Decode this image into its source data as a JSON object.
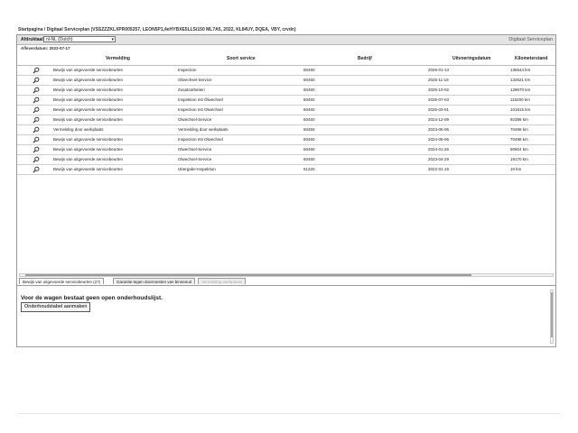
{
  "breadcrumb": "Startpagina / Digitaal Serviceplan (VSSZZZKLXPR005257, LEON5P1,4eHYBXE5LLSi150 ML7A5, 2022, KL84UY, DQEA, VBY, crvdn)",
  "toolbar": {
    "print_label": "Afdruktaal:",
    "language_value": "nl-NL (Dutch)",
    "app_title": "Digitaal Serviceplan"
  },
  "issue_date": "Afleverdatum: 2022-07-17",
  "table": {
    "columns": [
      "Vermelding",
      "Soort service",
      "Bedrijf",
      "Uitvoeringsdatum",
      "Kilometerstand"
    ],
    "rows": [
      {
        "vermelding": "Bewijs van uitgevoerde servicebeurten",
        "soort": "Inspection",
        "bedrijf": "60450",
        "datum": "2026-01-13",
        "km": "136544 km"
      },
      {
        "vermelding": "Bewijs van uitgevoerde servicebeurten",
        "soort": "Olieechsel-Service",
        "bedrijf": "60450",
        "datum": "2025-11-19",
        "km": "132621 km"
      },
      {
        "vermelding": "Bewijs van uitgevoerde servicebeurten",
        "soort": "Zusatzarbeiten",
        "bedrijf": "60450",
        "datum": "2025-10-02",
        "km": "128670 km"
      },
      {
        "vermelding": "Bewijs van uitgevoerde servicebeurten",
        "soort": "Inspektion mit Ölwechsel",
        "bedrijf": "60450",
        "datum": "2025-07-03",
        "km": "115200 km"
      },
      {
        "vermelding": "Bewijs van uitgevoerde servicebeurten",
        "soort": "Inspection mit Olwechsel",
        "bedrijf": "60450",
        "datum": "2025-03-01",
        "km": "101815 km"
      },
      {
        "vermelding": "Bewijs van uitgevoerde servicebeurten",
        "soort": "Olwechsel-Service",
        "bedrijf": "60450",
        "datum": "2024-12-09",
        "km": "92388 km"
      },
      {
        "vermelding": "Vermelding door werkplaats",
        "soort": "Vermelding door werkplaats",
        "bedrijf": "60450",
        "datum": "2024-06-06",
        "km": "70498 km"
      },
      {
        "vermelding": "Bewijs van uitgevoerde servicebeurten",
        "soort": "Inspection mit Olwechsel",
        "bedrijf": "60450",
        "datum": "2024-06-06",
        "km": "70498 km"
      },
      {
        "vermelding": "Bewijs van uitgevoerde servicebeurten",
        "soort": "Olwechsel-Service",
        "bedrijf": "60450",
        "datum": "2024-01-26",
        "km": "50804 km"
      },
      {
        "vermelding": "Bewijs van uitgevoerde servicebeurten",
        "soort": "Olwechsel-Service",
        "bedrijf": "60450",
        "datum": "2023-04-29",
        "km": "19170 km"
      },
      {
        "vermelding": "Bewijs van uitgevoerde servicebeurten",
        "soort": "Ubergabe-Inspektion",
        "bedrijf": "61220",
        "datum": "2022-01-19",
        "km": "10 km"
      }
    ]
  },
  "tabs": [
    {
      "label": "Bewijs van uitgevoerde servicebeurten (27)"
    },
    {
      "label": "Garantie tegen doorroesten van binnenuit"
    },
    {
      "label": "Vermelding werkplaats"
    }
  ],
  "panel": {
    "notice": "Voor de wagen bestaat geen open onderhoudslijst.",
    "create_button": "Onderhoudstabel aanmaken"
  },
  "icons": {
    "row_action": "magnifier-icon"
  }
}
